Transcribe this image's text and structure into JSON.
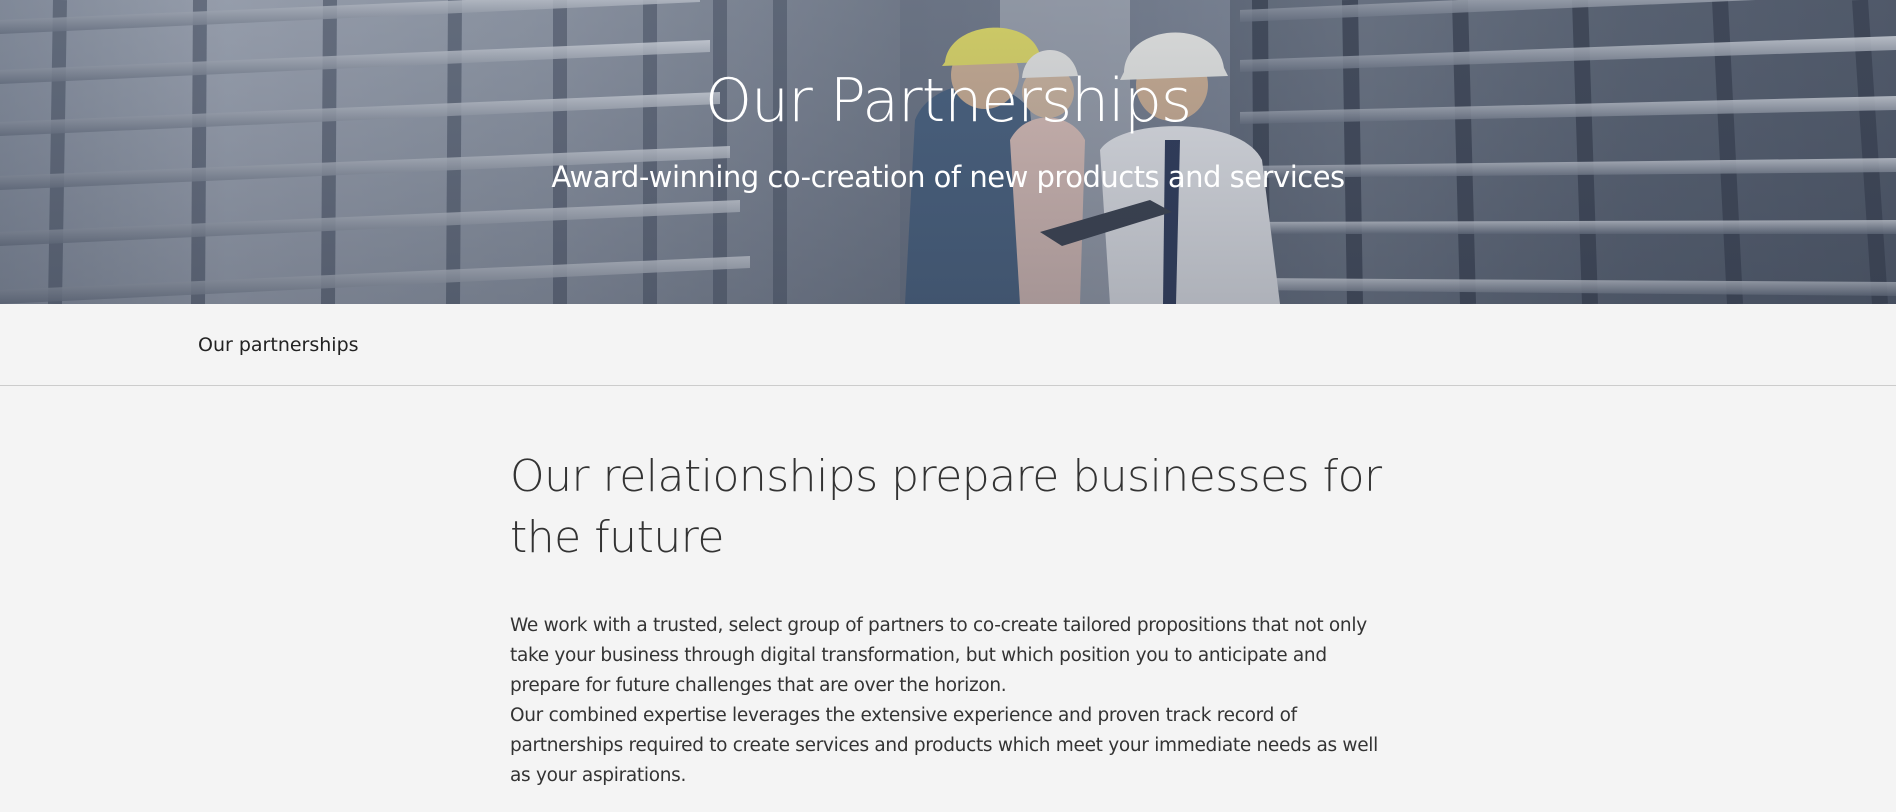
{
  "hero": {
    "title": "Our Partnerships",
    "subtitle": "Award-winning co-creation of new products and services",
    "image": "engineers-in-hard-hats-with-tablet"
  },
  "subnav": {
    "items": [
      {
        "label": "Our partnerships"
      }
    ]
  },
  "main": {
    "heading": "Our relationships prepare businesses for the future",
    "paragraphs": [
      "We work with a trusted, select group of partners to co-create tailored propositions that not only take your business through digital transformation, but which position you to anticipate and prepare for future challenges that are over the horizon.",
      "Our combined expertise leverages the extensive experience and proven track record of partnerships required to create services and products which meet your immediate needs as well as your aspirations."
    ]
  },
  "colors": {
    "page_background": "#f4f4f4",
    "text": "#333333",
    "hero_text": "#ffffff",
    "divider": "#cccccc"
  }
}
